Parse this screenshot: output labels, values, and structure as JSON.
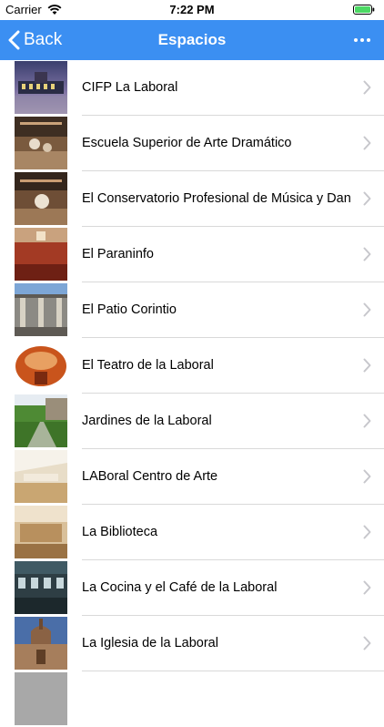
{
  "status_bar": {
    "carrier": "Carrier",
    "time": "7:22 PM"
  },
  "nav": {
    "back_label": "Back",
    "title": "Espacios",
    "accent": "#3b8ff2"
  },
  "list": {
    "items": [
      {
        "label": "CIFP La Laboral"
      },
      {
        "label": "Escuela Superior de Arte Dramático"
      },
      {
        "label": "El Conservatorio Profesional de Música y Danza"
      },
      {
        "label": "El Paraninfo"
      },
      {
        "label": "El Patio Corintio"
      },
      {
        "label": "El Teatro de la Laboral"
      },
      {
        "label": "Jardines de la Laboral"
      },
      {
        "label": "LABoral Centro de Arte"
      },
      {
        "label": "La Biblioteca"
      },
      {
        "label": "La Cocina y el Café de la Laboral"
      },
      {
        "label": "La Iglesia de la Laboral"
      }
    ]
  }
}
